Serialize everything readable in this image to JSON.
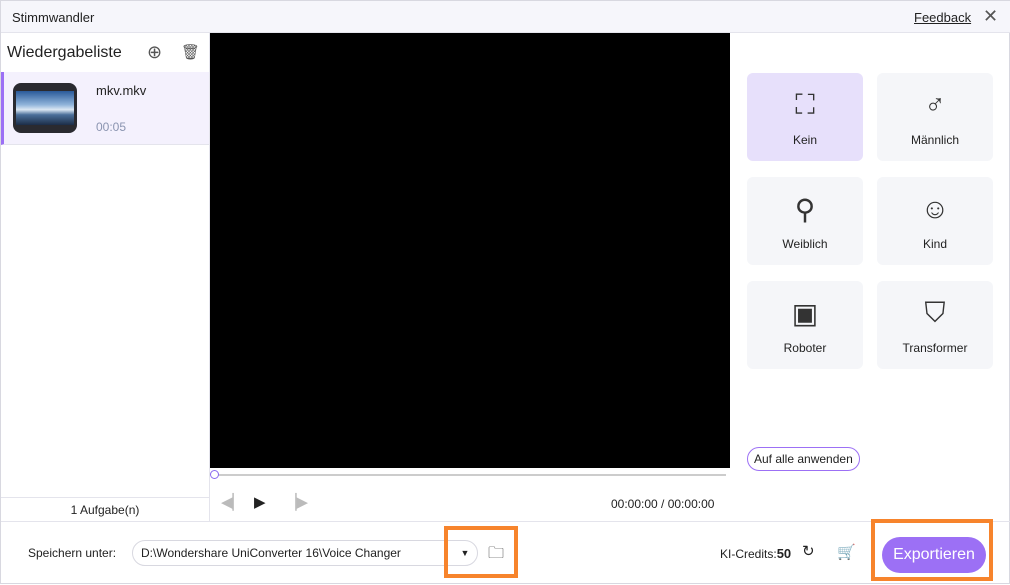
{
  "window": {
    "title": "Stimmwandler",
    "feedback": "Feedback"
  },
  "playlist": {
    "title": "Wiedergabeliste",
    "items": [
      {
        "name": "mkv.mkv",
        "duration": "00:05"
      }
    ],
    "tasks": "1 Aufgabe(n)"
  },
  "player": {
    "time": "00:00:00 / 00:00:00",
    "progress": 0
  },
  "effects": [
    {
      "label": "Kein",
      "icon": "frame-icon",
      "selected": true
    },
    {
      "label": "Männlich",
      "icon": "male-icon"
    },
    {
      "label": "Weiblich",
      "icon": "female-icon"
    },
    {
      "label": "Kind",
      "icon": "child-icon"
    },
    {
      "label": "Roboter",
      "icon": "robot-icon"
    },
    {
      "label": "Transformer",
      "icon": "transformer-icon"
    }
  ],
  "apply_all": "Auf alle anwenden",
  "bottom": {
    "save_label": "Speichern unter:",
    "path": "D:\\Wondershare UniConverter 16\\Voice Changer",
    "credits_label": "KI-Credits:",
    "credits": "50",
    "export": "Exportieren"
  },
  "colors": {
    "accent": "#9c70f5",
    "highlight": "#f7842c"
  }
}
